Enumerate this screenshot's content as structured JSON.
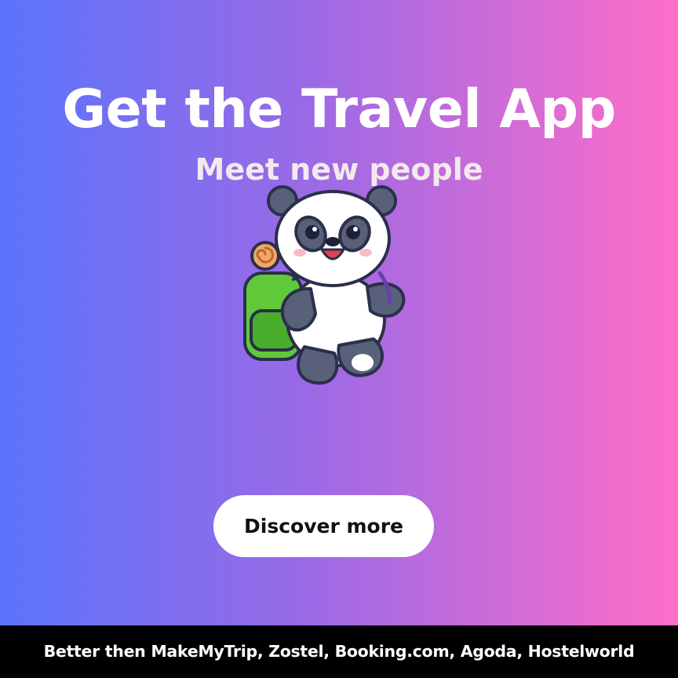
{
  "hero": {
    "title": "Get the Travel App",
    "subtitle": "Meet new people",
    "illustration": "panda-backpacker-icon",
    "cta_label": "Discover more"
  },
  "footer": {
    "text": "Better then MakeMyTrip, Zostel, Booking.com, Agoda, Hostelworld"
  },
  "colors": {
    "gradient_start": "#5a74fb",
    "gradient_end": "#ff6ec7",
    "footer_bg": "#000000",
    "button_bg": "#ffffff"
  }
}
